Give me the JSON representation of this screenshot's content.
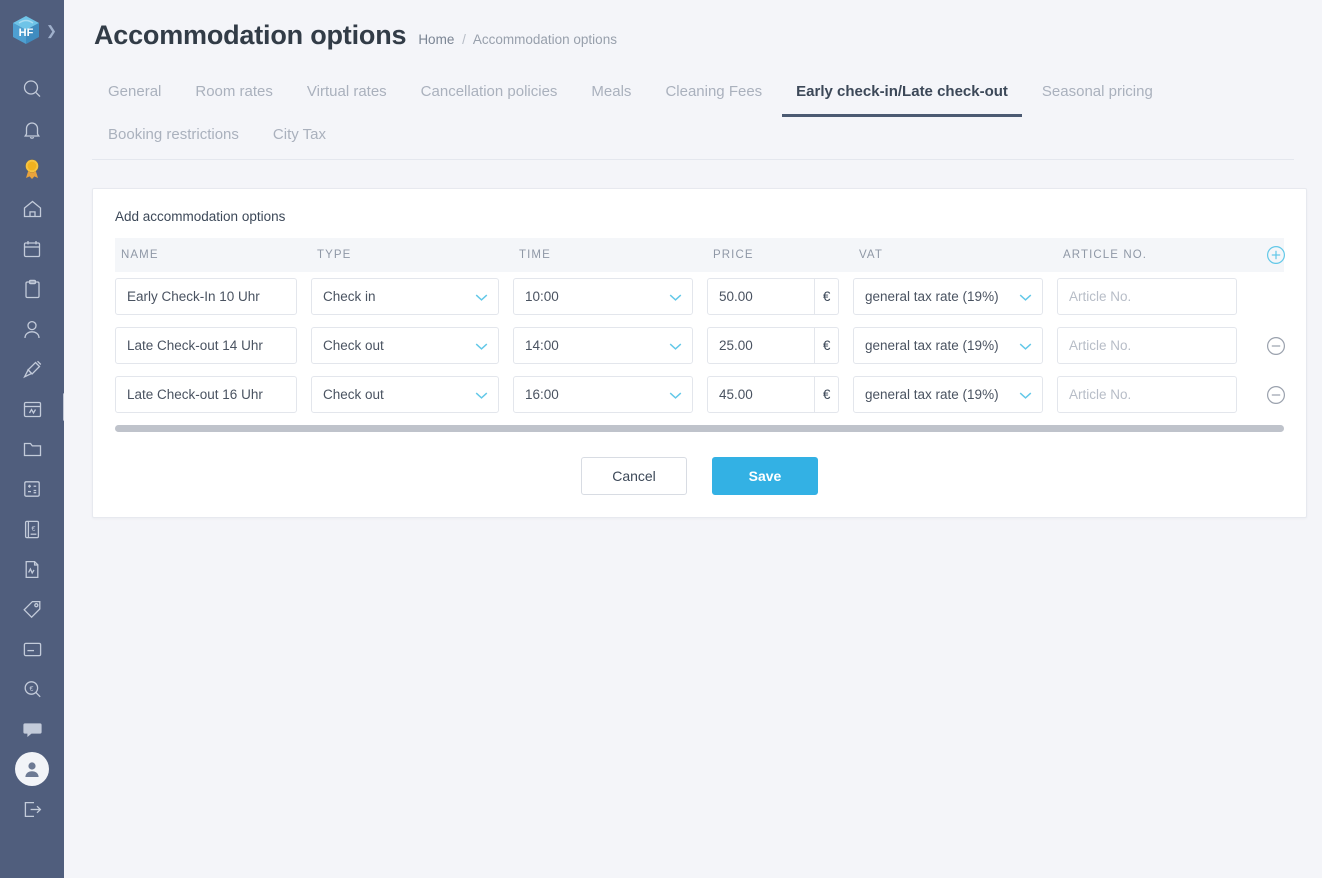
{
  "sidebar": {
    "logo": {
      "name": "hf-cube-logo",
      "text": "HF",
      "expand_icon": "chevron-right-icon"
    },
    "items": [
      {
        "name": "search-icon",
        "label": "Search"
      },
      {
        "name": "bell-icon",
        "label": "Notifications"
      },
      {
        "name": "medal-icon",
        "label": "Awards",
        "glyph": "🎖"
      },
      {
        "name": "home-icon",
        "label": "Home"
      },
      {
        "name": "calendar-icon",
        "label": "Calendar"
      },
      {
        "name": "clipboard-icon",
        "label": "Tasks"
      },
      {
        "name": "user-icon",
        "label": "Guests"
      },
      {
        "name": "cleaning-icon",
        "label": "Housekeeping"
      },
      {
        "name": "channel-icon",
        "label": "Channels"
      },
      {
        "name": "folder-icon",
        "label": "Documents"
      },
      {
        "name": "calculator-icon",
        "label": "Accounting"
      },
      {
        "name": "euro-book-icon",
        "label": "Invoices"
      },
      {
        "name": "report-icon",
        "label": "Reports"
      },
      {
        "name": "tag-icon",
        "label": "Rates"
      },
      {
        "name": "card-icon",
        "label": "Payments"
      },
      {
        "name": "magnifier-euro-icon",
        "label": "Price check"
      },
      {
        "name": "chat-icon",
        "label": "Messages"
      },
      {
        "name": "avatar-icon",
        "label": "Account"
      },
      {
        "name": "logout-icon",
        "label": "Log out"
      }
    ]
  },
  "header": {
    "title": "Accommodation options",
    "breadcrumb": {
      "home": "Home",
      "separator": "/",
      "current": "Accommodation options"
    }
  },
  "tabs": [
    {
      "label": "General",
      "active": false
    },
    {
      "label": "Room rates",
      "active": false
    },
    {
      "label": "Virtual rates",
      "active": false
    },
    {
      "label": "Cancellation policies",
      "active": false
    },
    {
      "label": "Meals",
      "active": false
    },
    {
      "label": "Cleaning Fees",
      "active": false
    },
    {
      "label": "Early check-in/Late check-out",
      "active": true
    },
    {
      "label": "Seasonal pricing",
      "active": false
    },
    {
      "label": "Booking restrictions",
      "active": false
    },
    {
      "label": "City Tax",
      "active": false
    }
  ],
  "card": {
    "title": "Add accommodation options",
    "columns": [
      "NAME",
      "TYPE",
      "TIME",
      "PRICE",
      "VAT",
      "ARTICLE NO."
    ],
    "add_row_icon": "plus-circle-icon",
    "remove_row_icon": "minus-circle-icon",
    "currency_symbol": "€",
    "article_placeholder": "Article No.",
    "rows": [
      {
        "name": "Early Check-In 10 Uhr",
        "type": "Check in",
        "time": "10:00",
        "price": "50.00",
        "vat": "general tax rate (19%)",
        "article_no": "",
        "removable": false
      },
      {
        "name": "Late Check-out 14 Uhr",
        "type": "Check out",
        "time": "14:00",
        "price": "25.00",
        "vat": "general tax rate (19%)",
        "article_no": "",
        "removable": true
      },
      {
        "name": "Late Check-out 16 Uhr",
        "type": "Check out",
        "time": "16:00",
        "price": "45.00",
        "vat": "general tax rate (19%)",
        "article_no": "",
        "removable": true
      }
    ],
    "cancel_label": "Cancel",
    "save_label": "Save"
  },
  "colors": {
    "sidebar_bg": "#505e7d",
    "page_bg": "#f4f5f9",
    "accent_blue": "#33b1e4",
    "chevron_teal": "#62c8e8",
    "active_tab_underline": "#4b5a72",
    "text_dark": "#3c4858",
    "text_muted": "#aab1bd"
  }
}
